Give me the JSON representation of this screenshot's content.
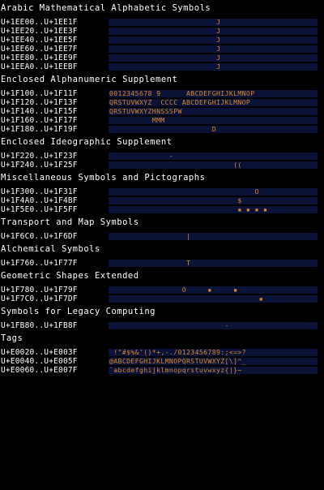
{
  "sections": [
    {
      "title": "Arabic Mathematical Alphabetic Symbols",
      "rows": [
        {
          "range": "U+1EE00..U+1EE1F",
          "glyphs": "                         J"
        },
        {
          "range": "U+1EE20..U+1EE3F",
          "glyphs": "                         J"
        },
        {
          "range": "U+1EE40..U+1EE5F",
          "glyphs": "                         J"
        },
        {
          "range": "U+1EE60..U+1EE7F",
          "glyphs": "                         J"
        },
        {
          "range": "U+1EE80..U+1EE9F",
          "glyphs": "                         J"
        },
        {
          "range": "U+1EEA0..U+1EEBF",
          "glyphs": "                         J"
        }
      ]
    },
    {
      "title": "Enclosed Alphanumeric Supplement",
      "rows": [
        {
          "range": "U+1F100..U+1F11F",
          "glyphs": "0012345678 9      ABCDEFGHIJKLMNOP"
        },
        {
          "range": "U+1F120..U+1F13F",
          "glyphs": "QRSTUVWXYZ  CCCC ABCDEFGHIJKLMNOP"
        },
        {
          "range": "U+1F140..U+1F15F",
          "glyphs": "QRSTUVWXYZHNSSSPW"
        },
        {
          "range": "U+1F160..U+1F17F",
          "glyphs": "          MMM"
        },
        {
          "range": "U+1F180..U+1F19F",
          "glyphs": "                        D"
        }
      ]
    },
    {
      "title": "Enclosed Ideographic Supplement",
      "rows": [
        {
          "range": "U+1F220..U+1F23F",
          "glyphs": "              -"
        },
        {
          "range": "U+1F240..U+1F25F",
          "glyphs": "                             ((  "
        }
      ]
    },
    {
      "title": "Miscellaneous Symbols and Pictographs",
      "rows": [
        {
          "range": "U+1F300..U+1F31F",
          "glyphs": "                                  O"
        },
        {
          "range": "U+1F4A0..U+1F4BF",
          "glyphs": "                              $"
        },
        {
          "range": "U+1F5E0..U+1F5FF",
          "glyphs": "                              ▪ ▪ ▪ ▪"
        }
      ]
    },
    {
      "title": "Transport and Map Symbols",
      "rows": [
        {
          "range": "U+1F6C0..U+1F6DF",
          "glyphs": "                  |"
        }
      ]
    },
    {
      "title": "Alchemical Symbols",
      "rows": [
        {
          "range": "U+1F760..U+1F77F",
          "glyphs": "                  T"
        }
      ]
    },
    {
      "title": "Geometric Shapes Extended",
      "rows": [
        {
          "range": "U+1F780..U+1F79F",
          "glyphs": "                 O     ▪     ▪"
        },
        {
          "range": "U+1F7C0..U+1F7DF",
          "glyphs": "                                   ▪"
        }
      ]
    },
    {
      "title": "Symbols for Legacy Computing",
      "rows": [
        {
          "range": "U+1FB80..U+1FB8F",
          "glyphs": "                           -"
        }
      ]
    },
    {
      "title": "Tags",
      "rows": [
        {
          "range": "U+E0020..U+E003F",
          "glyphs": " !\"#$%&'()*+,-./0123456789:;<=>?"
        },
        {
          "range": "U+E0040..U+E005F",
          "glyphs": "@ABCDEFGHIJKLMNOPQRSTUVWXYZ[\\]^_"
        },
        {
          "range": "U+E0060..U+E007F",
          "glyphs": "`abcdefghijklmnopqrstuvwxyz{|}~"
        }
      ]
    }
  ],
  "colors": {
    "background": "#000000",
    "row_band": "#0b1238",
    "glyph": "#d9892a",
    "text": "#ffffff"
  }
}
